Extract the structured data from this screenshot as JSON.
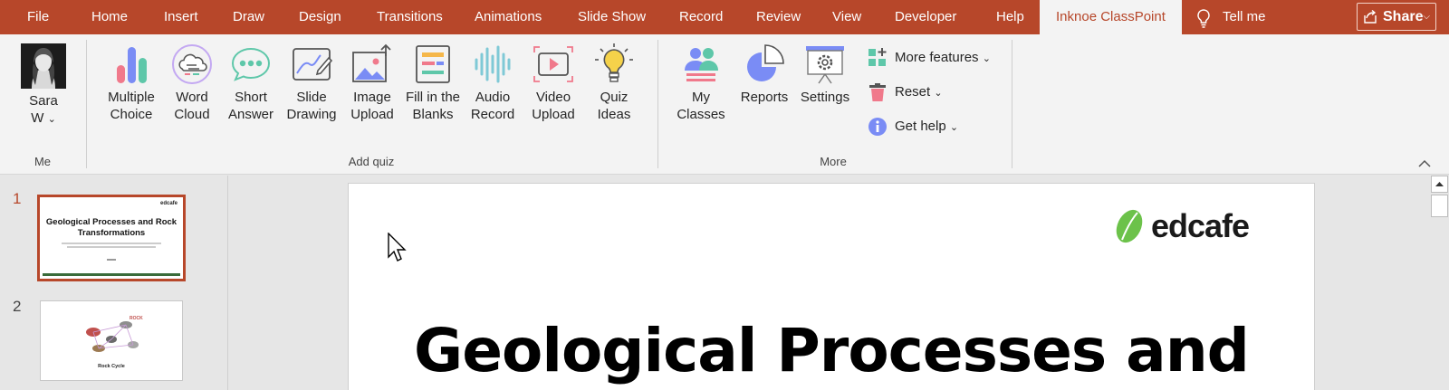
{
  "menu": {
    "tabs": [
      "File",
      "Home",
      "Insert",
      "Draw",
      "Design",
      "Transitions",
      "Animations",
      "Slide Show",
      "Record",
      "Review",
      "View",
      "Developer",
      "Help",
      "Inknoe ClassPoint"
    ],
    "active_tab": "Inknoe ClassPoint",
    "tell_me": "Tell me",
    "share": "Share",
    "accent_color": "#b7472a"
  },
  "ribbon": {
    "me": {
      "name_line1": "Sara",
      "name_line2": "W",
      "group_label": "Me"
    },
    "add_quiz": {
      "group_label": "Add quiz",
      "buttons": [
        {
          "line1": "Multiple",
          "line2": "Choice",
          "icon": "bar-chart-icon"
        },
        {
          "line1": "Word",
          "line2": "Cloud",
          "icon": "word-cloud-icon"
        },
        {
          "line1": "Short",
          "line2": "Answer",
          "icon": "speech-bubble-icon"
        },
        {
          "line1": "Slide",
          "line2": "Drawing",
          "icon": "drawing-icon"
        },
        {
          "line1": "Image",
          "line2": "Upload",
          "icon": "image-upload-icon"
        },
        {
          "line1": "Fill in the",
          "line2": "Blanks",
          "icon": "fill-blanks-icon"
        },
        {
          "line1": "Audio",
          "line2": "Record",
          "icon": "audio-wave-icon"
        },
        {
          "line1": "Video",
          "line2": "Upload",
          "icon": "video-upload-icon"
        },
        {
          "line1": "Quiz",
          "line2": "Ideas",
          "icon": "lightbulb-icon"
        }
      ]
    },
    "more": {
      "group_label": "More",
      "buttons": [
        {
          "line1": "My",
          "line2": "Classes",
          "icon": "classes-icon"
        },
        {
          "line1": "Reports",
          "line2": "",
          "icon": "pie-chart-icon"
        },
        {
          "line1": "Settings",
          "line2": "",
          "icon": "settings-icon"
        }
      ],
      "small": [
        {
          "label": "More features",
          "icon": "grid-plus-icon"
        },
        {
          "label": "Reset",
          "icon": "trash-icon"
        },
        {
          "label": "Get help",
          "icon": "info-icon"
        }
      ]
    }
  },
  "slides": {
    "thumbs": [
      {
        "number": "1",
        "title": "Geological Processes and Rock Transformations",
        "logo": "edcafe"
      },
      {
        "number": "2",
        "title": "Rock Cycle"
      }
    ]
  },
  "slide": {
    "title": "Geological Processes and",
    "brand": "edcafe"
  }
}
